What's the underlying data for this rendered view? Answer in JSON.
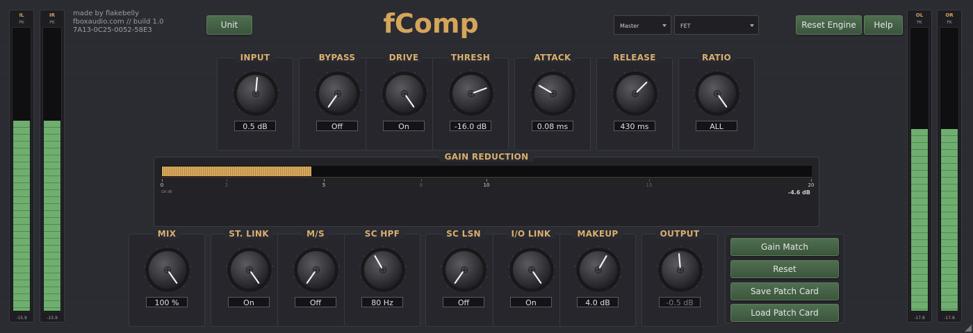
{
  "meters": {
    "il": {
      "label": "IL",
      "pk": "PK",
      "value": "-15.9",
      "level": 0.67
    },
    "ir": {
      "label": "IR",
      "pk": "PK",
      "value": "-15.9",
      "level": 0.67
    },
    "ol": {
      "label": "OL",
      "pk": "PK",
      "value": "-17.8",
      "level": 0.64
    },
    "or": {
      "label": "OR",
      "pk": "PK",
      "value": "-17.8",
      "level": 0.64
    }
  },
  "header": {
    "info_line1": "made by flakebelly",
    "info_line2": "fboxaudio.com // build 1.0",
    "info_line3": "7A13-0C25-0052-58E3",
    "unit_label": "Unit",
    "title": "fComp",
    "select_master": "Master",
    "select_mode": "FET",
    "reset_engine_label": "Reset Engine",
    "help_label": "Help"
  },
  "knobs_top": [
    {
      "label": "INPUT",
      "value": "0.5 dB",
      "angle": 5
    },
    {
      "label": "BYPASS",
      "value": "Off",
      "angle": -145
    },
    {
      "label": "DRIVE",
      "value": "On",
      "angle": 145
    },
    {
      "label": "THRESH",
      "value": "-16.0 dB",
      "angle": 70
    },
    {
      "label": "ATTACK",
      "value": "0.08 ms",
      "angle": -60
    },
    {
      "label": "RELEASE",
      "value": "430 ms",
      "angle": 45
    },
    {
      "label": "RATIO",
      "value": "ALL",
      "angle": 145
    }
  ],
  "knobs_bottom": [
    {
      "label": "MIX",
      "value": "100 %",
      "angle": 145
    },
    {
      "label": "ST. LINK",
      "value": "On",
      "angle": 145
    },
    {
      "label": "M/S",
      "value": "Off",
      "angle": -145
    },
    {
      "label": "SC HPF",
      "value": "80 Hz",
      "angle": -30
    },
    {
      "label": "SC LSN",
      "value": "Off",
      "angle": -145
    },
    {
      "label": "I/O LINK",
      "value": "On",
      "angle": 145
    },
    {
      "label": "MAKEUP",
      "value": "4.0 dB",
      "angle": 30
    },
    {
      "label": "OUTPUT",
      "value": "-0.5 dB",
      "angle": -5
    }
  ],
  "gain_reduction": {
    "label": "GAIN REDUCTION",
    "value": "-4.6 dB",
    "fill_fraction": 0.23,
    "axis_label": "GR dB",
    "ticks_major": [
      "0",
      "5",
      "10",
      "20"
    ],
    "ticks_minor": [
      "2",
      "8",
      "15"
    ]
  },
  "buttons": {
    "gain_match": "Gain Match",
    "reset": "Reset",
    "save_patch": "Save Patch Card",
    "load_patch": "Load Patch Card"
  },
  "colors": {
    "accent": "#d4a55a",
    "button_green": "#4f6f50",
    "meter_green": "#6fae6f",
    "background": "#2a2a31"
  }
}
